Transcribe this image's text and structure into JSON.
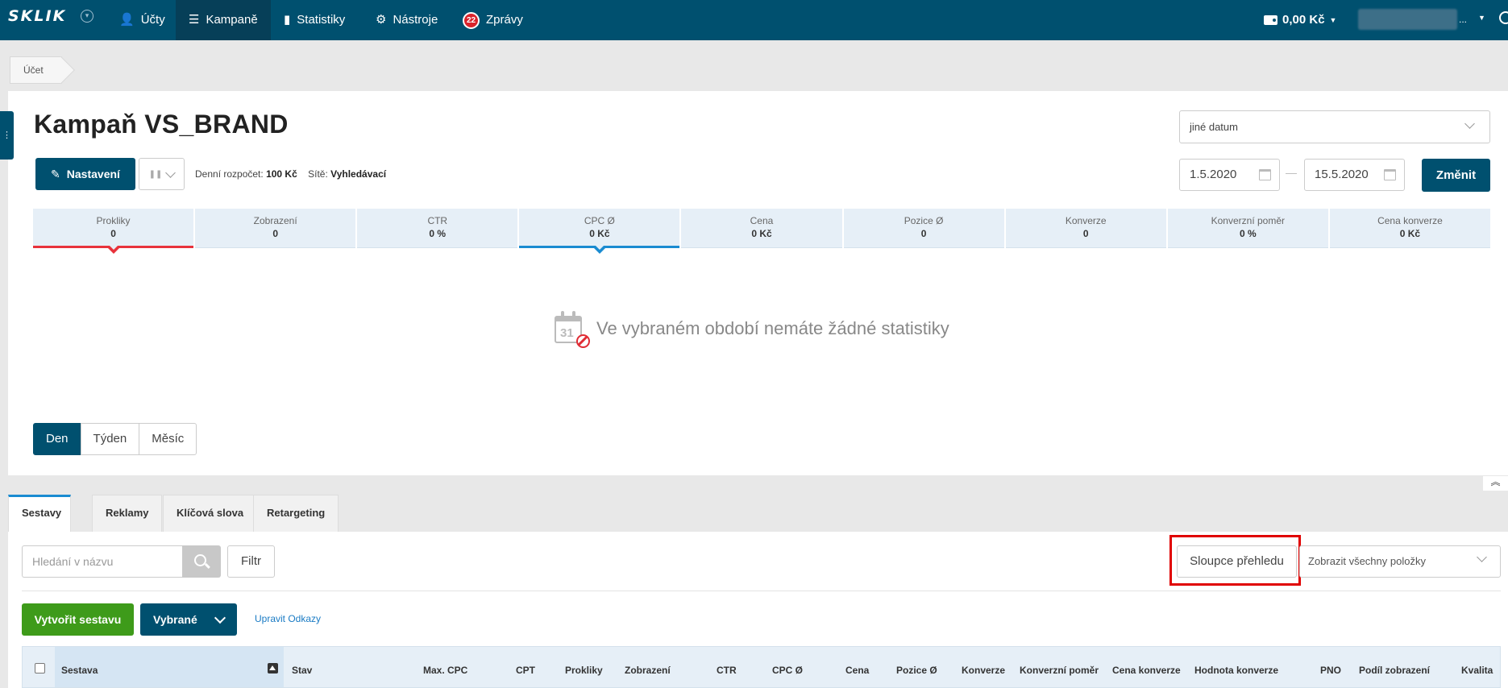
{
  "topnav": {
    "logo": "SKLIK",
    "items": [
      {
        "label": "Účty",
        "icon": "accounts-icon"
      },
      {
        "label": "Kampaně",
        "icon": "list-icon"
      },
      {
        "label": "Statistiky",
        "icon": "bar-chart-icon"
      },
      {
        "label": "Nástroje",
        "icon": "gear-icon"
      },
      {
        "label": "Zprávy",
        "icon": "messages-badge-icon",
        "badge": "22"
      }
    ],
    "active_item": "Kampaně",
    "balance": "0,00 Kč",
    "user_suffix": "..."
  },
  "breadcrumb": {
    "item": "Účet"
  },
  "campaign": {
    "title": "Kampaň VS_BRAND",
    "settings_label": "Nastavení",
    "budget_label": "Denní rozpočet:",
    "budget_value": "100 Kč",
    "networks_label": "Sítě:",
    "networks_value": "Vyhledávací"
  },
  "date": {
    "range_select": "jiné datum",
    "from": "1.5.2020",
    "to": "15.5.2020",
    "separator": "—",
    "change_label": "Změnit"
  },
  "stats": [
    {
      "label": "Prokliky",
      "value": "0",
      "selected": "red"
    },
    {
      "label": "Zobrazení",
      "value": "0"
    },
    {
      "label": "CTR",
      "value": "0 %"
    },
    {
      "label": "CPC Ø",
      "value": "0 Kč",
      "selected": "blue"
    },
    {
      "label": "Cena",
      "value": "0 Kč"
    },
    {
      "label": "Pozice Ø",
      "value": "0"
    },
    {
      "label": "Konverze",
      "value": "0"
    },
    {
      "label": "Konverzní poměr",
      "value": "0 %"
    },
    {
      "label": "Cena konverze",
      "value": "0 Kč"
    }
  ],
  "empty_state": {
    "calendar_number": "31",
    "text": "Ve vybraném období nemáte žádné statistiky"
  },
  "period": {
    "day": "Den",
    "week": "Týden",
    "month": "Měsíc",
    "active": "Den"
  },
  "tabs": {
    "sets": "Sestavy",
    "ads": "Reklamy",
    "keywords": "Klíčová slova",
    "retargeting": "Retargeting",
    "active": "Sestavy"
  },
  "toolbar": {
    "search_placeholder": "Hledání v názvu",
    "filter_label": "Filtr",
    "columns_label": "Sloupce přehledu",
    "show_select": "Zobrazit všechny položky",
    "create_label": "Vytvořit sestavu",
    "selected_label": "Vybrané",
    "edit_links": "Upravit Odkazy"
  },
  "table": {
    "columns": [
      "Sestava",
      "Stav",
      "Max. CPC",
      "CPT",
      "Prokliky",
      "Zobrazení",
      "CTR",
      "CPC Ø",
      "Cena",
      "Pozice Ø",
      "Konverze",
      "Konverzní poměr",
      "Cena konverze",
      "Hodnota konverze",
      "PNO",
      "Podíl zobrazení",
      "Kvalita"
    ]
  },
  "colors": {
    "brand": "#00506f",
    "accent_green": "#3e9b1a",
    "highlight_red": "#e00000",
    "selected_red": "#e8323b",
    "selected_blue": "#1a8bd1"
  }
}
